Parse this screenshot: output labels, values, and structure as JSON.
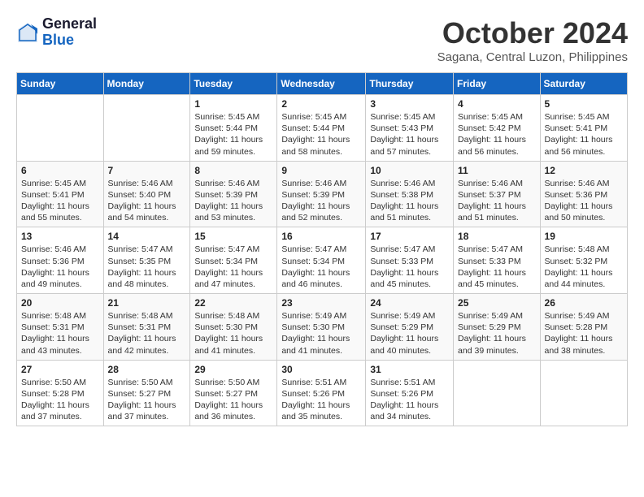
{
  "header": {
    "logo_general": "General",
    "logo_blue": "Blue",
    "month_title": "October 2024",
    "location": "Sagana, Central Luzon, Philippines"
  },
  "weekdays": [
    "Sunday",
    "Monday",
    "Tuesday",
    "Wednesday",
    "Thursday",
    "Friday",
    "Saturday"
  ],
  "weeks": [
    [
      {
        "day": "",
        "info": ""
      },
      {
        "day": "",
        "info": ""
      },
      {
        "day": "1",
        "info": "Sunrise: 5:45 AM\nSunset: 5:44 PM\nDaylight: 11 hours and 59 minutes."
      },
      {
        "day": "2",
        "info": "Sunrise: 5:45 AM\nSunset: 5:44 PM\nDaylight: 11 hours and 58 minutes."
      },
      {
        "day": "3",
        "info": "Sunrise: 5:45 AM\nSunset: 5:43 PM\nDaylight: 11 hours and 57 minutes."
      },
      {
        "day": "4",
        "info": "Sunrise: 5:45 AM\nSunset: 5:42 PM\nDaylight: 11 hours and 56 minutes."
      },
      {
        "day": "5",
        "info": "Sunrise: 5:45 AM\nSunset: 5:41 PM\nDaylight: 11 hours and 56 minutes."
      }
    ],
    [
      {
        "day": "6",
        "info": "Sunrise: 5:45 AM\nSunset: 5:41 PM\nDaylight: 11 hours and 55 minutes."
      },
      {
        "day": "7",
        "info": "Sunrise: 5:46 AM\nSunset: 5:40 PM\nDaylight: 11 hours and 54 minutes."
      },
      {
        "day": "8",
        "info": "Sunrise: 5:46 AM\nSunset: 5:39 PM\nDaylight: 11 hours and 53 minutes."
      },
      {
        "day": "9",
        "info": "Sunrise: 5:46 AM\nSunset: 5:39 PM\nDaylight: 11 hours and 52 minutes."
      },
      {
        "day": "10",
        "info": "Sunrise: 5:46 AM\nSunset: 5:38 PM\nDaylight: 11 hours and 51 minutes."
      },
      {
        "day": "11",
        "info": "Sunrise: 5:46 AM\nSunset: 5:37 PM\nDaylight: 11 hours and 51 minutes."
      },
      {
        "day": "12",
        "info": "Sunrise: 5:46 AM\nSunset: 5:36 PM\nDaylight: 11 hours and 50 minutes."
      }
    ],
    [
      {
        "day": "13",
        "info": "Sunrise: 5:46 AM\nSunset: 5:36 PM\nDaylight: 11 hours and 49 minutes."
      },
      {
        "day": "14",
        "info": "Sunrise: 5:47 AM\nSunset: 5:35 PM\nDaylight: 11 hours and 48 minutes."
      },
      {
        "day": "15",
        "info": "Sunrise: 5:47 AM\nSunset: 5:34 PM\nDaylight: 11 hours and 47 minutes."
      },
      {
        "day": "16",
        "info": "Sunrise: 5:47 AM\nSunset: 5:34 PM\nDaylight: 11 hours and 46 minutes."
      },
      {
        "day": "17",
        "info": "Sunrise: 5:47 AM\nSunset: 5:33 PM\nDaylight: 11 hours and 45 minutes."
      },
      {
        "day": "18",
        "info": "Sunrise: 5:47 AM\nSunset: 5:33 PM\nDaylight: 11 hours and 45 minutes."
      },
      {
        "day": "19",
        "info": "Sunrise: 5:48 AM\nSunset: 5:32 PM\nDaylight: 11 hours and 44 minutes."
      }
    ],
    [
      {
        "day": "20",
        "info": "Sunrise: 5:48 AM\nSunset: 5:31 PM\nDaylight: 11 hours and 43 minutes."
      },
      {
        "day": "21",
        "info": "Sunrise: 5:48 AM\nSunset: 5:31 PM\nDaylight: 11 hours and 42 minutes."
      },
      {
        "day": "22",
        "info": "Sunrise: 5:48 AM\nSunset: 5:30 PM\nDaylight: 11 hours and 41 minutes."
      },
      {
        "day": "23",
        "info": "Sunrise: 5:49 AM\nSunset: 5:30 PM\nDaylight: 11 hours and 41 minutes."
      },
      {
        "day": "24",
        "info": "Sunrise: 5:49 AM\nSunset: 5:29 PM\nDaylight: 11 hours and 40 minutes."
      },
      {
        "day": "25",
        "info": "Sunrise: 5:49 AM\nSunset: 5:29 PM\nDaylight: 11 hours and 39 minutes."
      },
      {
        "day": "26",
        "info": "Sunrise: 5:49 AM\nSunset: 5:28 PM\nDaylight: 11 hours and 38 minutes."
      }
    ],
    [
      {
        "day": "27",
        "info": "Sunrise: 5:50 AM\nSunset: 5:28 PM\nDaylight: 11 hours and 37 minutes."
      },
      {
        "day": "28",
        "info": "Sunrise: 5:50 AM\nSunset: 5:27 PM\nDaylight: 11 hours and 37 minutes."
      },
      {
        "day": "29",
        "info": "Sunrise: 5:50 AM\nSunset: 5:27 PM\nDaylight: 11 hours and 36 minutes."
      },
      {
        "day": "30",
        "info": "Sunrise: 5:51 AM\nSunset: 5:26 PM\nDaylight: 11 hours and 35 minutes."
      },
      {
        "day": "31",
        "info": "Sunrise: 5:51 AM\nSunset: 5:26 PM\nDaylight: 11 hours and 34 minutes."
      },
      {
        "day": "",
        "info": ""
      },
      {
        "day": "",
        "info": ""
      }
    ]
  ]
}
